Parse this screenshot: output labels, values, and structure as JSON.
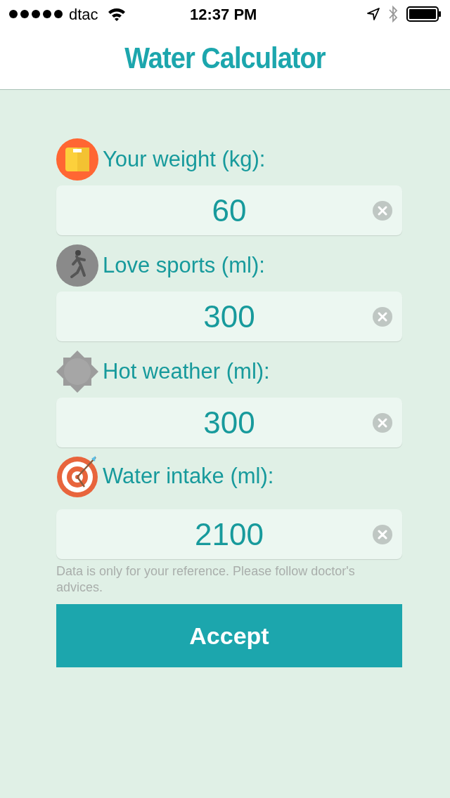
{
  "status_bar": {
    "carrier": "dtac",
    "time": "12:37 PM"
  },
  "nav": {
    "title": "Water Calculator"
  },
  "inputs": [
    {
      "kind": "scale",
      "label": "Your weight (kg):",
      "value": "60"
    },
    {
      "kind": "runner",
      "label": "Love sports (ml):",
      "value": "300"
    },
    {
      "kind": "sun",
      "label": "Hot weather (ml):",
      "value": "300"
    },
    {
      "kind": "target",
      "label": "Water intake (ml):",
      "value": "2100"
    }
  ],
  "note": "Data is only for your reference. Please follow doctor's advices.",
  "button": "Accept"
}
